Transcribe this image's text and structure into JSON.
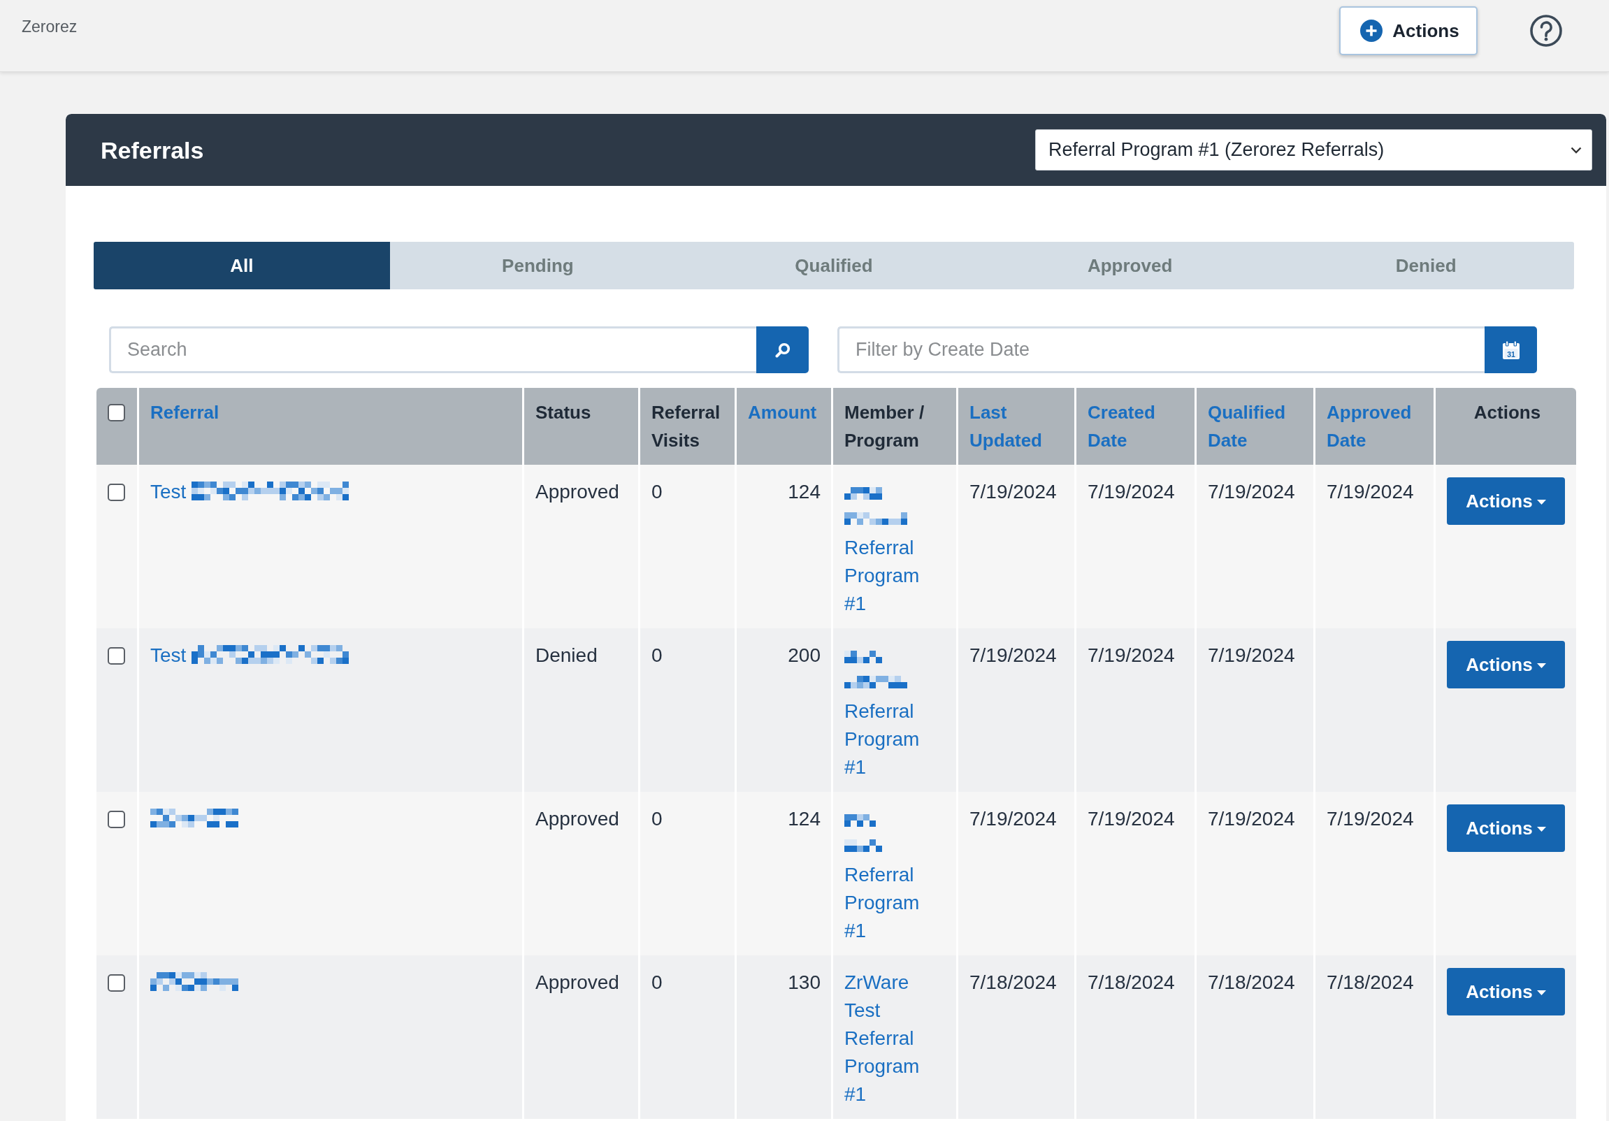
{
  "top_bar": {
    "brand": "Zerorez",
    "actions_button": "Actions"
  },
  "panel": {
    "title": "Referrals",
    "program_select": {
      "value": "Referral Program #1 (Zerorez Referrals)"
    }
  },
  "tabs": [
    {
      "label": "All",
      "selected": true
    },
    {
      "label": "Pending",
      "selected": false
    },
    {
      "label": "Qualified",
      "selected": false
    },
    {
      "label": "Approved",
      "selected": false
    },
    {
      "label": "Denied",
      "selected": false
    }
  ],
  "search": {
    "placeholder": "Search"
  },
  "date_filter": {
    "placeholder": "Filter by Create Date",
    "calendar_day": "31"
  },
  "table": {
    "select_all": {
      "checked": false
    },
    "columns": [
      {
        "label": "Referral",
        "sortable": true
      },
      {
        "label": "Status",
        "sortable": false
      },
      {
        "label": "Referral Visits",
        "sortable": false
      },
      {
        "label": "Amount",
        "sortable": true
      },
      {
        "label": "Member / Program",
        "sortable": false
      },
      {
        "label": "Last Updated",
        "sortable": true
      },
      {
        "label": "Created Date",
        "sortable": true
      },
      {
        "label": "Qualified Date",
        "sortable": true
      },
      {
        "label": "Approved Date",
        "sortable": true
      },
      {
        "label": "Actions",
        "sortable": false
      }
    ],
    "rows": [
      {
        "checked": false,
        "referral": {
          "text": "Test",
          "redacted": true
        },
        "status": "Approved",
        "referral_visits": "0",
        "amount": "124",
        "member": {
          "redacted": true
        },
        "program": "Referral Program #1",
        "last_updated": "7/19/2024",
        "created_date": "7/19/2024",
        "qualified_date": "7/19/2024",
        "approved_date": "7/19/2024",
        "actions_button": "Actions"
      },
      {
        "checked": false,
        "referral": {
          "text": "Test",
          "redacted": true
        },
        "status": "Denied",
        "referral_visits": "0",
        "amount": "200",
        "member": {
          "redacted": true
        },
        "program": "Referral Program #1",
        "last_updated": "7/19/2024",
        "created_date": "7/19/2024",
        "qualified_date": "7/19/2024",
        "actions_button": "Actions"
      },
      {
        "checked": false,
        "referral": {
          "redacted": true
        },
        "status": "Approved",
        "referral_visits": "0",
        "amount": "124",
        "member": {
          "redacted": true
        },
        "program": "Referral Program #1",
        "last_updated": "7/19/2024",
        "created_date": "7/19/2024",
        "qualified_date": "7/19/2024",
        "approved_date": "7/19/2024",
        "actions_button": "Actions"
      },
      {
        "checked": false,
        "referral": {
          "redacted": true
        },
        "status": "Approved",
        "referral_visits": "0",
        "amount": "130",
        "member": {
          "name": "ZrWare Test",
          "redacted": false
        },
        "program": "Referral Program #1",
        "last_updated": "7/18/2024",
        "created_date": "7/18/2024",
        "qualified_date": "7/18/2024",
        "approved_date": "7/18/2024",
        "actions_button": "Actions"
      }
    ]
  }
}
